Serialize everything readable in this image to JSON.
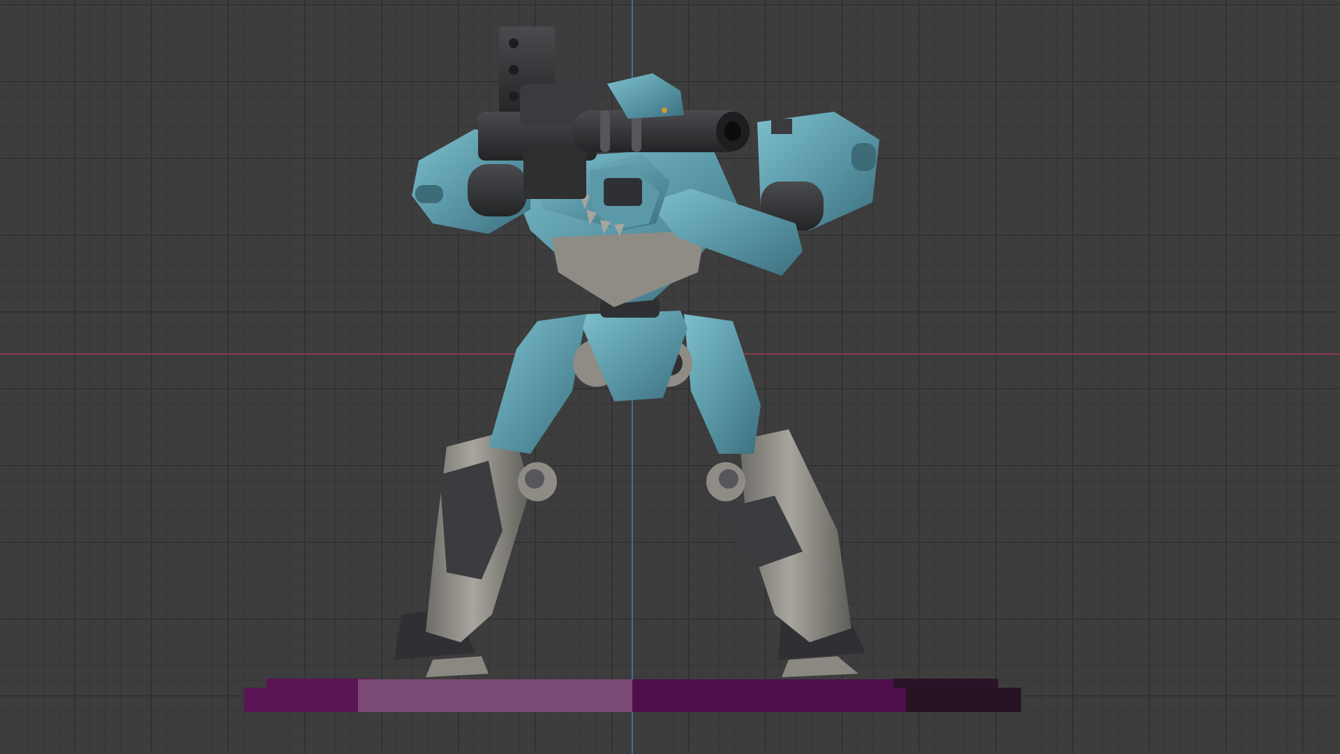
{
  "viewport": {
    "background_color": "#3d3d3d",
    "grid_minor_color": "#363636",
    "grid_major_color": "#2f2f2f",
    "axis_x_color": "#8a3a48",
    "axis_y_color": "#3f6f9a"
  },
  "model": {
    "subject": "mech-robot-with-shoulder-cannon",
    "body_color": "#5b99a8",
    "armor_color": "#8e8c85",
    "joint_color": "#3a3b3e",
    "weapon_color": "#2e2f31"
  },
  "ground_bar": {
    "segments": [
      {
        "color": "#5a1554"
      },
      {
        "color": "#7a4a74"
      },
      {
        "color": "#4e0f4c"
      },
      {
        "color": "#261222"
      }
    ]
  }
}
